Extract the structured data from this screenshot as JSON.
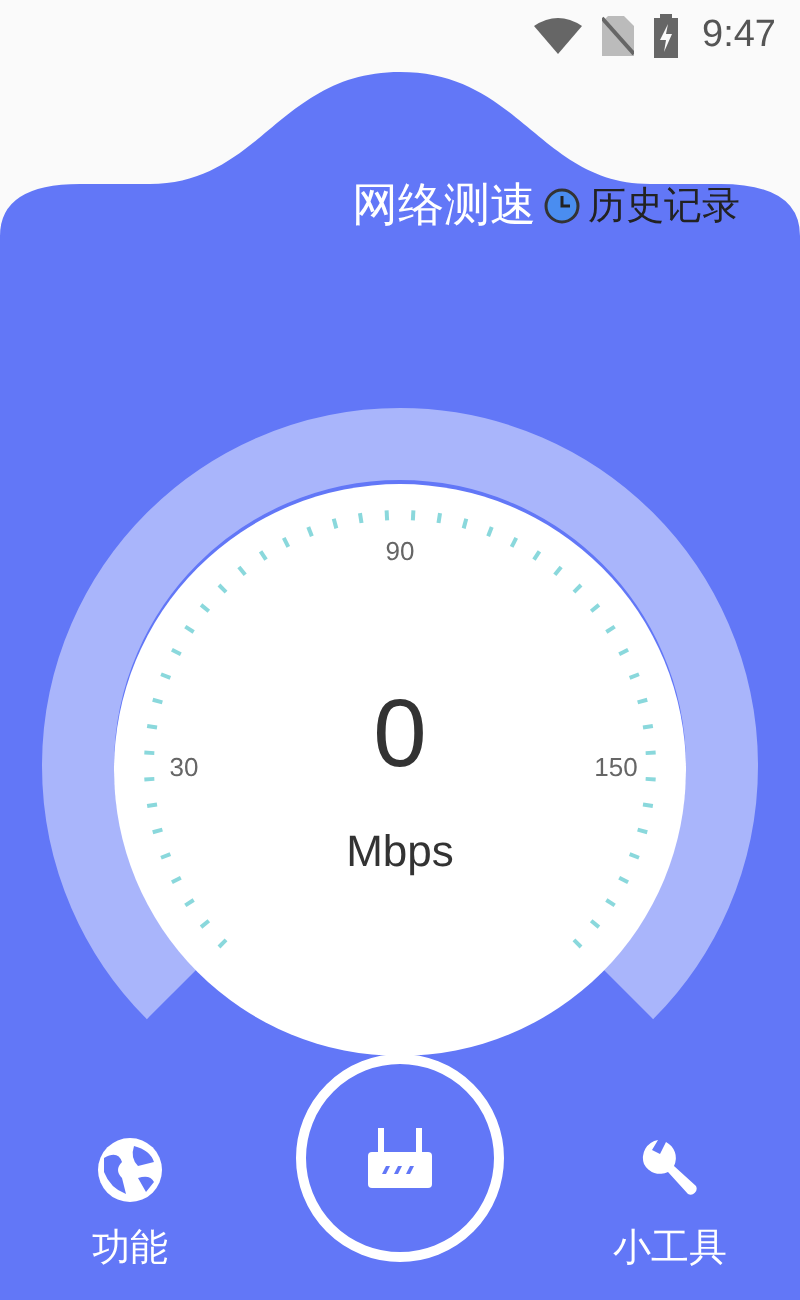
{
  "status_bar": {
    "time": "9:47"
  },
  "header": {
    "title": "网络测速",
    "history_link": "历史记录"
  },
  "gauge": {
    "scale_labels": [
      "30",
      "90",
      "150"
    ],
    "reading": "0",
    "unit": "Mbps"
  },
  "bottom_nav": [
    {
      "kind": "globe",
      "label": "功能"
    },
    {
      "kind": "router"
    },
    {
      "kind": "wrench",
      "label": "小工具"
    }
  ]
}
